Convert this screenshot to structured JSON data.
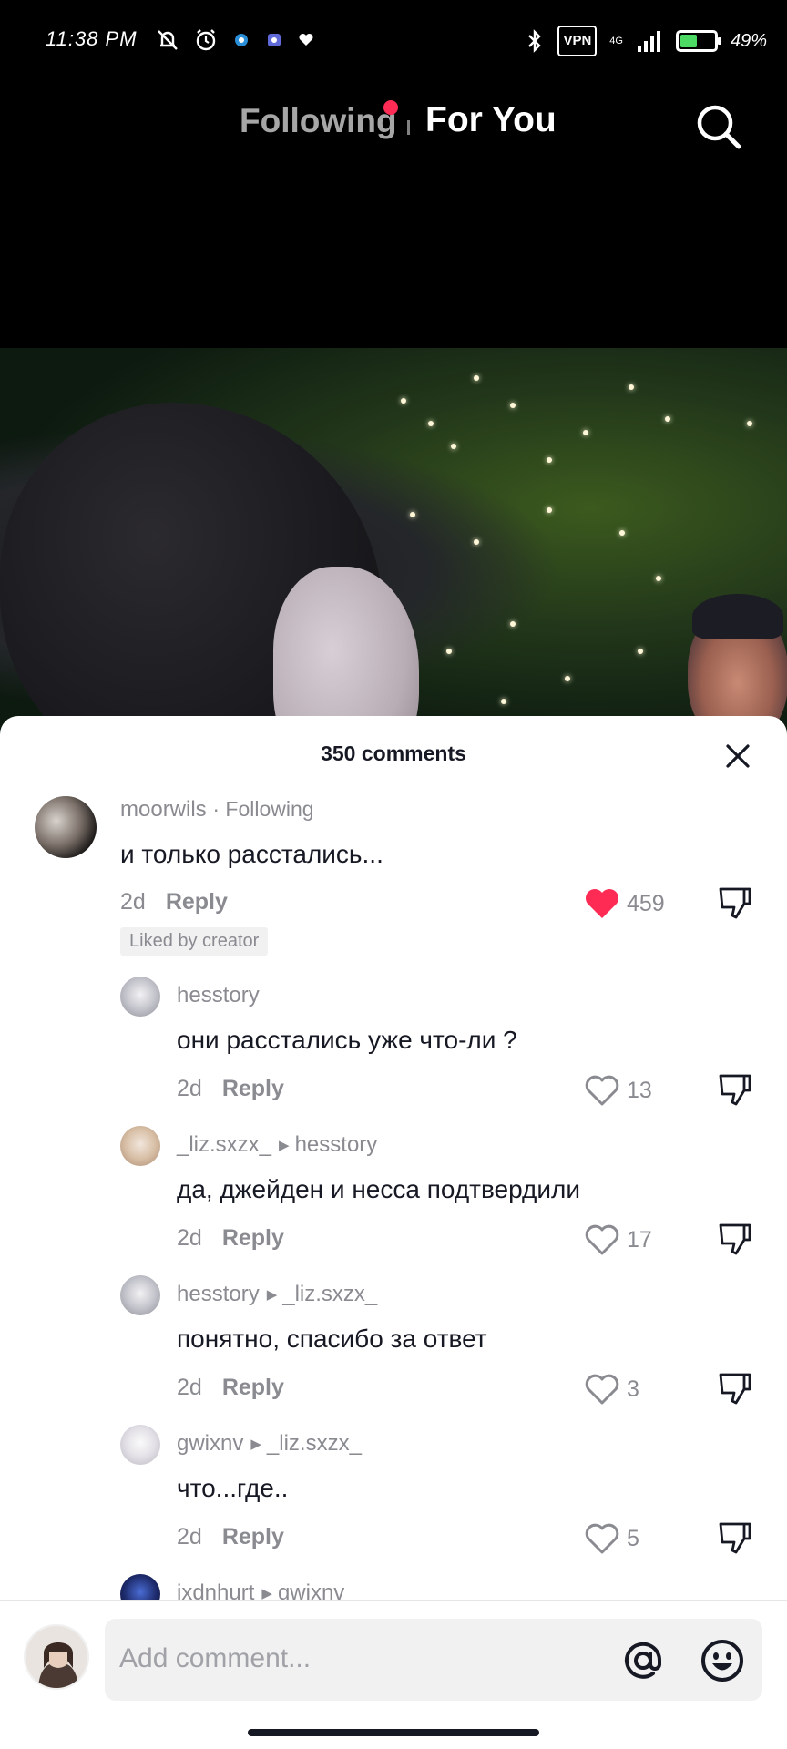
{
  "status_bar": {
    "time": "11:38 PM",
    "vpn_label": "VPN",
    "network_label": "4G",
    "battery_level": 0.49,
    "battery_text": "49%"
  },
  "top_nav": {
    "following_label": "Following",
    "for_you_label": "For You",
    "has_unread_dot": true,
    "active_tab": "For You"
  },
  "comments_panel": {
    "title": "350 comments",
    "comments": [
      {
        "username": "moorwils",
        "following_tag": "· Following",
        "text": "и только расстались...",
        "age": "2d",
        "reply_label": "Reply",
        "likes": "459",
        "liked": true,
        "badge": "Liked by creator"
      },
      {
        "username": "hesstory",
        "text": "они расстались уже что-ли ?",
        "age": "2d",
        "reply_label": "Reply",
        "likes": "13"
      },
      {
        "username": "_liz.sxzx_",
        "reply_to": "hesstory",
        "text": "да, джейден и несса подтвердили",
        "age": "2d",
        "reply_label": "Reply",
        "likes": "17"
      },
      {
        "username": "hesstory",
        "reply_to": "_liz.sxzx_",
        "text": "понятно, спасибо за ответ",
        "age": "2d",
        "reply_label": "Reply",
        "likes": "3"
      },
      {
        "username": "gwixnv",
        "reply_to": "_liz.sxzx_",
        "text": "что...где..",
        "age": "2d",
        "reply_label": "Reply",
        "likes": "5"
      },
      {
        "username": "ixdnhurt",
        "reply_to": "gwixnv"
      }
    ]
  },
  "composer": {
    "placeholder": "Add comment...",
    "icons": [
      "at-icon",
      "emoji-icon"
    ]
  },
  "colors": {
    "accent_red": "#fe2c55",
    "text_primary": "#161823",
    "text_secondary": "#8a8b91",
    "input_bg": "#f1f1f2"
  }
}
